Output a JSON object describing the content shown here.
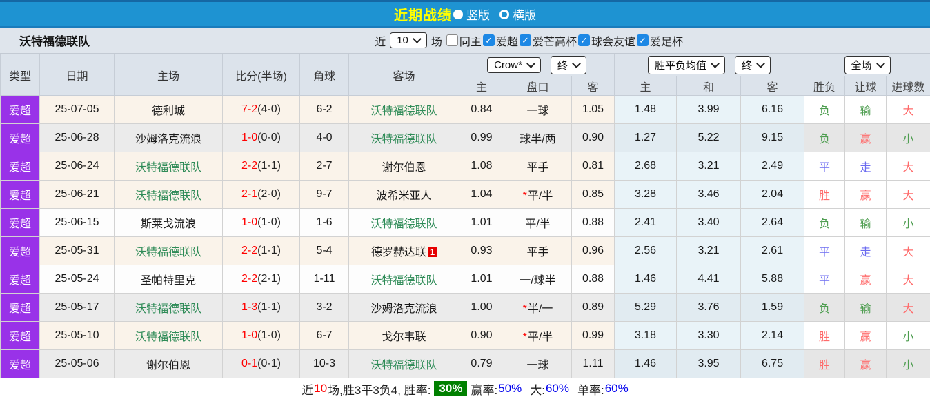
{
  "title_bar": {
    "title": "近期战绩",
    "radios": [
      {
        "label": "竖版",
        "selected": true
      },
      {
        "label": "横版",
        "selected": false
      }
    ]
  },
  "filter_bar": {
    "team_name": "沃特福德联队",
    "near_label": "近",
    "rounds_value": "10",
    "rounds_suffix": "场",
    "checkboxes": [
      {
        "label": "同主",
        "checked": false
      },
      {
        "label": "爱超",
        "checked": true
      },
      {
        "label": "爱芒高杯",
        "checked": true
      },
      {
        "label": "球会友谊",
        "checked": true
      },
      {
        "label": "爱足杯",
        "checked": true
      }
    ]
  },
  "table": {
    "headers": {
      "type": "类型",
      "date": "日期",
      "home": "主场",
      "score": "比分(半场)",
      "corner": "角球",
      "away": "客场",
      "asia_select": "Crow*",
      "asia_state_select": "终",
      "asia_sub": [
        "主",
        "盘口",
        "客"
      ],
      "europe_select": "胜平负均值",
      "europe_state_select": "终",
      "europe_sub": [
        "主",
        "和",
        "客"
      ],
      "scope_select": "全场",
      "result_sub": [
        "胜负",
        "让球",
        "进球数"
      ]
    },
    "rows": [
      {
        "bg": "cream",
        "league": "爱超",
        "date": "25-07-05",
        "home": "德利城",
        "home_color": "black",
        "score": "7-2",
        "half": "(4-0)",
        "corner": "6-2",
        "away": "沃特福德联队",
        "away_color": "green",
        "away_badge": null,
        "odds_home": "0.84",
        "handicap": "一球",
        "star": false,
        "odds_away": "1.05",
        "avg_win": "1.48",
        "avg_draw": "3.99",
        "avg_lose": "6.16",
        "result": {
          "text": "负",
          "color": "green"
        },
        "handicap_result": {
          "text": "输",
          "color": "green"
        },
        "goals_result": {
          "text": "大",
          "color": "red"
        }
      },
      {
        "bg": "gray",
        "league": "爱超",
        "date": "25-06-28",
        "home": "沙姆洛克流浪",
        "home_color": "black",
        "score": "1-0",
        "half": "(0-0)",
        "corner": "4-0",
        "away": "沃特福德联队",
        "away_color": "green",
        "away_badge": null,
        "odds_home": "0.99",
        "handicap": "球半/两",
        "star": false,
        "odds_away": "0.90",
        "avg_win": "1.27",
        "avg_draw": "5.22",
        "avg_lose": "9.15",
        "result": {
          "text": "负",
          "color": "green"
        },
        "handicap_result": {
          "text": "赢",
          "color": "red"
        },
        "goals_result": {
          "text": "小",
          "color": "green"
        }
      },
      {
        "bg": "cream",
        "league": "爱超",
        "date": "25-06-24",
        "home": "沃特福德联队",
        "home_color": "green",
        "score": "2-2",
        "half": "(1-1)",
        "corner": "2-7",
        "away": "谢尔伯恩",
        "away_color": "black",
        "away_badge": null,
        "odds_home": "1.08",
        "handicap": "平手",
        "star": false,
        "odds_away": "0.81",
        "avg_win": "2.68",
        "avg_draw": "3.21",
        "avg_lose": "2.49",
        "result": {
          "text": "平",
          "color": "blue"
        },
        "handicap_result": {
          "text": "走",
          "color": "blue"
        },
        "goals_result": {
          "text": "大",
          "color": "red"
        }
      },
      {
        "bg": "cream",
        "league": "爱超",
        "date": "25-06-21",
        "home": "沃特福德联队",
        "home_color": "green",
        "score": "2-1",
        "half": "(2-0)",
        "corner": "9-7",
        "away": "波希米亚人",
        "away_color": "black",
        "away_badge": null,
        "odds_home": "1.04",
        "handicap": "平/半",
        "star": true,
        "odds_away": "0.85",
        "avg_win": "3.28",
        "avg_draw": "3.46",
        "avg_lose": "2.04",
        "result": {
          "text": "胜",
          "color": "red"
        },
        "handicap_result": {
          "text": "赢",
          "color": "red"
        },
        "goals_result": {
          "text": "大",
          "color": "red"
        }
      },
      {
        "bg": "white",
        "league": "爱超",
        "date": "25-06-15",
        "home": "斯莱戈流浪",
        "home_color": "black",
        "score": "1-0",
        "half": "(1-0)",
        "corner": "1-6",
        "away": "沃特福德联队",
        "away_color": "green",
        "away_badge": null,
        "odds_home": "1.01",
        "handicap": "平/半",
        "star": false,
        "odds_away": "0.88",
        "avg_win": "2.41",
        "avg_draw": "3.40",
        "avg_lose": "2.64",
        "result": {
          "text": "负",
          "color": "green"
        },
        "handicap_result": {
          "text": "输",
          "color": "green"
        },
        "goals_result": {
          "text": "小",
          "color": "green"
        }
      },
      {
        "bg": "cream",
        "league": "爱超",
        "date": "25-05-31",
        "home": "沃特福德联队",
        "home_color": "green",
        "score": "2-2",
        "half": "(1-1)",
        "corner": "5-4",
        "away": "德罗赫达联",
        "away_color": "black",
        "away_badge": "1",
        "odds_home": "0.93",
        "handicap": "平手",
        "star": false,
        "odds_away": "0.96",
        "avg_win": "2.56",
        "avg_draw": "3.21",
        "avg_lose": "2.61",
        "result": {
          "text": "平",
          "color": "blue"
        },
        "handicap_result": {
          "text": "走",
          "color": "blue"
        },
        "goals_result": {
          "text": "大",
          "color": "red"
        }
      },
      {
        "bg": "white",
        "league": "爱超",
        "date": "25-05-24",
        "home": "圣帕特里克",
        "home_color": "black",
        "score": "2-2",
        "half": "(2-1)",
        "corner": "1-11",
        "away": "沃特福德联队",
        "away_color": "green",
        "away_badge": null,
        "odds_home": "1.01",
        "handicap": "一/球半",
        "star": false,
        "odds_away": "0.88",
        "avg_win": "1.46",
        "avg_draw": "4.41",
        "avg_lose": "5.88",
        "result": {
          "text": "平",
          "color": "blue"
        },
        "handicap_result": {
          "text": "赢",
          "color": "red"
        },
        "goals_result": {
          "text": "大",
          "color": "red"
        }
      },
      {
        "bg": "gray",
        "league": "爱超",
        "date": "25-05-17",
        "home": "沃特福德联队",
        "home_color": "green",
        "score": "1-3",
        "half": "(1-1)",
        "corner": "3-2",
        "away": "沙姆洛克流浪",
        "away_color": "black",
        "away_badge": null,
        "odds_home": "1.00",
        "handicap": "半/一",
        "star": true,
        "odds_away": "0.89",
        "avg_win": "5.29",
        "avg_draw": "3.76",
        "avg_lose": "1.59",
        "result": {
          "text": "负",
          "color": "green"
        },
        "handicap_result": {
          "text": "输",
          "color": "green"
        },
        "goals_result": {
          "text": "大",
          "color": "red"
        }
      },
      {
        "bg": "cream",
        "league": "爱超",
        "date": "25-05-10",
        "home": "沃特福德联队",
        "home_color": "green",
        "score": "1-0",
        "half": "(1-0)",
        "corner": "6-7",
        "away": "戈尔韦联",
        "away_color": "black",
        "away_badge": null,
        "odds_home": "0.90",
        "handicap": "平/半",
        "star": true,
        "odds_away": "0.99",
        "avg_win": "3.18",
        "avg_draw": "3.30",
        "avg_lose": "2.14",
        "result": {
          "text": "胜",
          "color": "red"
        },
        "handicap_result": {
          "text": "赢",
          "color": "red"
        },
        "goals_result": {
          "text": "小",
          "color": "green"
        }
      },
      {
        "bg": "gray",
        "league": "爱超",
        "date": "25-05-06",
        "home": "谢尔伯恩",
        "home_color": "black",
        "score": "0-1",
        "half": "(0-1)",
        "corner": "10-3",
        "away": "沃特福德联队",
        "away_color": "green",
        "away_badge": null,
        "odds_home": "0.79",
        "handicap": "一球",
        "star": false,
        "odds_away": "1.11",
        "avg_win": "1.46",
        "avg_draw": "3.95",
        "avg_lose": "6.75",
        "result": {
          "text": "胜",
          "color": "red"
        },
        "handicap_result": {
          "text": "赢",
          "color": "red"
        },
        "goals_result": {
          "text": "小",
          "color": "green"
        }
      }
    ]
  },
  "summary": {
    "near": "近",
    "count": "10",
    "detail": "场,胜3平3负4, 胜率:",
    "win_rate": "30%",
    "win_odds_label": "赢率:",
    "win_odds_value": "50%",
    "big_label": "大:",
    "big_value": "60%",
    "single_label": "单率:",
    "single_value": "60%"
  },
  "colors": {
    "topbar_blue": "#1e93d2",
    "title_yellow": "#ffff00",
    "type_purple": "#9932e8",
    "team_green": "#2e8b57",
    "score_red": "#ff0000",
    "result_red": "#ff6b6b",
    "result_green": "#4f9e51",
    "result_blue": "#6b6bf0",
    "rate_badge_green": "#008000",
    "summary_value_blue": "#0000ee",
    "checkbox_blue": "#1d88e5"
  }
}
